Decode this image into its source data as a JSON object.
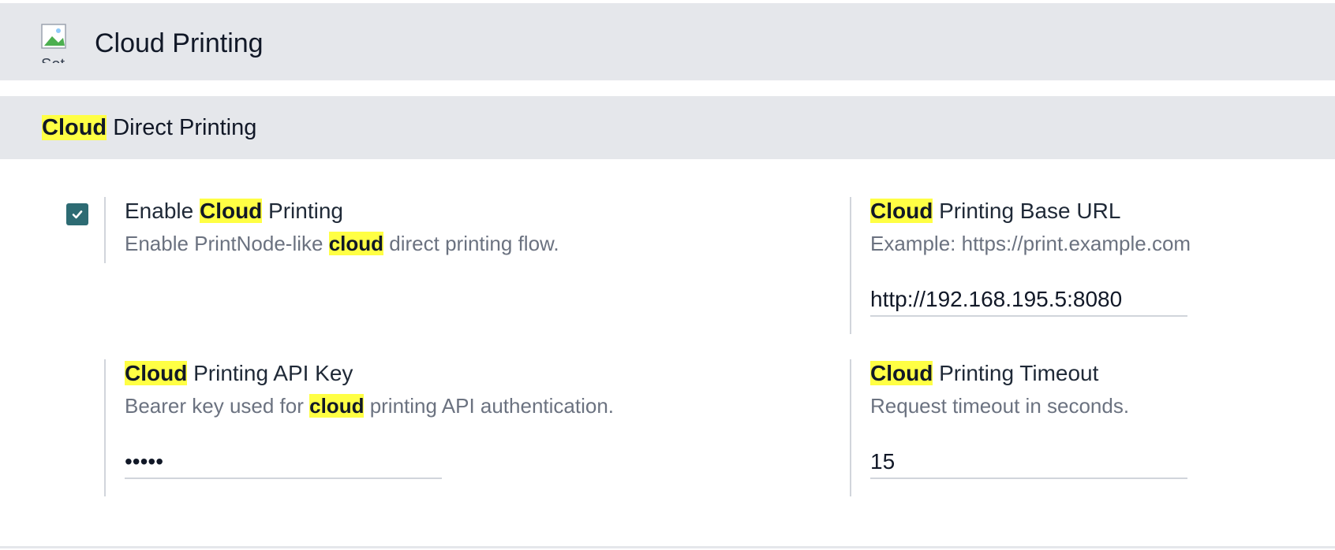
{
  "header": {
    "icon_name": "settings-app-icon",
    "icon_alt": "Set",
    "title": "Cloud Printing"
  },
  "section": {
    "title_highlight": "Cloud",
    "title_rest": " Direct Printing"
  },
  "settings": {
    "enable": {
      "checked": true,
      "label_pre": "Enable ",
      "label_highlight": "Cloud",
      "label_post": " Printing",
      "help_pre": "Enable PrintNode-like ",
      "help_highlight": "cloud",
      "help_post": " direct printing flow."
    },
    "base_url": {
      "label_highlight": "Cloud",
      "label_post": " Printing Base URL",
      "help": "Example: https://print.example.com",
      "value": "http://192.168.195.5:8080"
    },
    "api_key": {
      "label_highlight": "Cloud",
      "label_post": " Printing API Key",
      "help_pre": "Bearer key used for ",
      "help_highlight": "cloud",
      "help_post": " printing API authentication.",
      "value": "•••••"
    },
    "timeout": {
      "label_highlight": "Cloud",
      "label_post": " Printing Timeout",
      "help": "Request timeout in seconds.",
      "value": "15"
    }
  },
  "colors": {
    "header_bg": "#e5e7eb",
    "highlight": "#ffff44",
    "checkbox": "#2d6b73"
  }
}
